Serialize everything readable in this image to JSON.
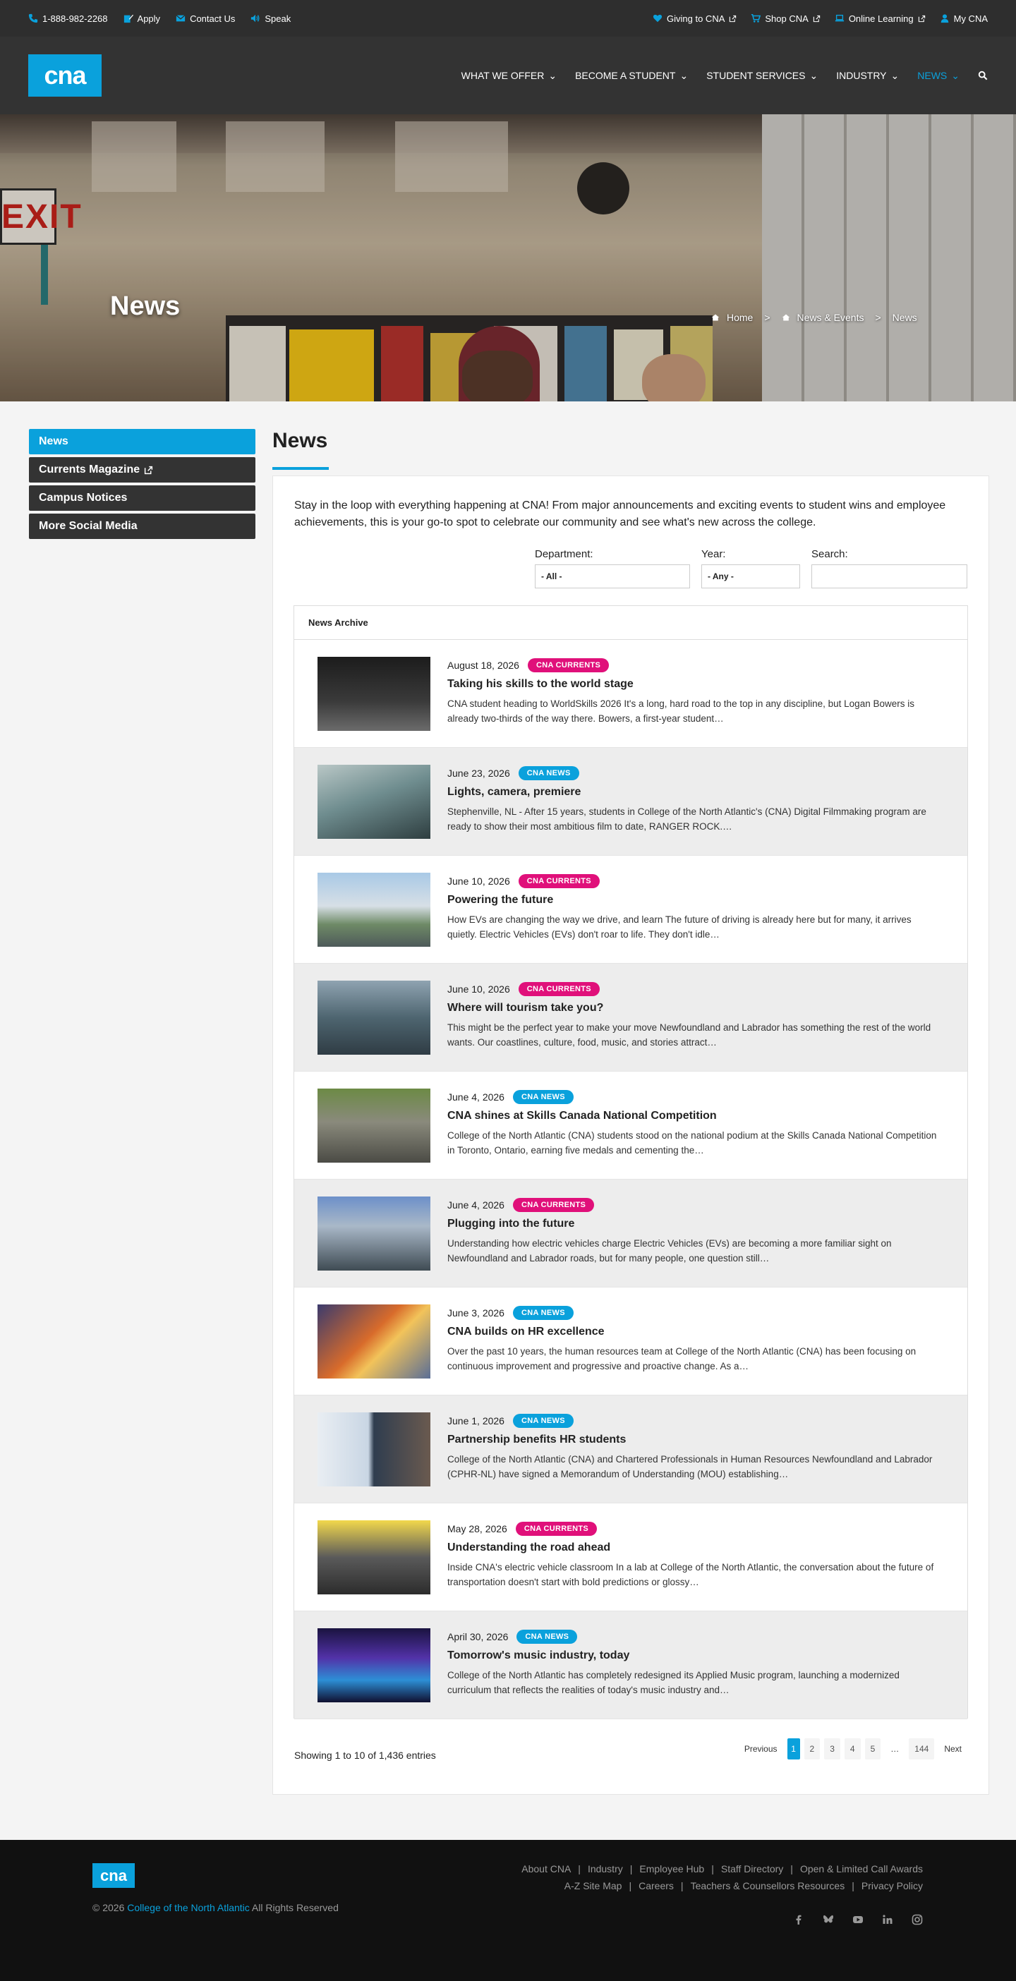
{
  "topbar": {
    "phone": "1-888-982-2268",
    "apply": "Apply",
    "contact": "Contact Us",
    "speak": "Speak",
    "giving": "Giving to CNA",
    "shop": "Shop CNA",
    "learning": "Online Learning",
    "mycna": "My CNA"
  },
  "nav": {
    "logo": "cna",
    "items": [
      "WHAT WE OFFER",
      "BECOME A STUDENT",
      "STUDENT SERVICES",
      "INDUSTRY",
      "NEWS"
    ]
  },
  "hero": {
    "title": "News",
    "exit_sign": "EXIT",
    "crumbs": [
      "Home",
      "News & Events",
      "News"
    ]
  },
  "sidebar": {
    "items": [
      "News",
      "Currents Magazine",
      "Campus Notices",
      "More Social Media"
    ]
  },
  "main": {
    "title": "News",
    "intro": "Stay in the loop with everything happening at CNA! From major announcements and exciting events to student wins and employee achievements, this is your go-to spot to celebrate our community and see what's new across the college.",
    "filters": {
      "department_label": "Department:",
      "department_value": "- All -",
      "year_label": "Year:",
      "year_value": "- Any -",
      "search_label": "Search:",
      "search_value": ""
    },
    "archive_title": "News Archive",
    "articles": [
      {
        "date": "August 18, 2026",
        "tag": "CNA CURRENTS",
        "title": "Taking his skills to the world stage",
        "excerpt": "CNA student heading to WorldSkills 2026 It's a long, hard road to the top in any discipline, but Logan Bowers is already two-thirds of the way there. Bowers, a first-year student…"
      },
      {
        "date": "June 23, 2026",
        "tag": "CNA NEWS",
        "title": "Lights, camera, premiere",
        "excerpt": "Stephenville, NL - After 15 years, students in College of the North Atlantic's (CNA) Digital Filmmaking program are ready to show their most ambitious film to date, RANGER ROCK.…"
      },
      {
        "date": "June 10, 2026",
        "tag": "CNA CURRENTS",
        "title": "Powering the future",
        "excerpt": "How EVs are changing the way we drive, and learn The future of driving is already here but for many, it arrives quietly. Electric Vehicles (EVs) don't roar to life. They don't idle…"
      },
      {
        "date": "June 10, 2026",
        "tag": "CNA CURRENTS",
        "title": "Where will tourism take you?",
        "excerpt": "This might be the perfect year to make your move Newfoundland and Labrador has something the rest of the world wants. Our coastlines, culture, food, music, and stories attract…"
      },
      {
        "date": "June 4, 2026",
        "tag": "CNA NEWS",
        "title": "CNA shines at Skills Canada National Competition",
        "excerpt": "College of the North Atlantic (CNA) students stood on the national podium at the Skills Canada National Competition in Toronto, Ontario, earning five medals and cementing the…"
      },
      {
        "date": "June 4, 2026",
        "tag": "CNA CURRENTS",
        "title": "Plugging into the future",
        "excerpt": "Understanding how electric vehicles charge Electric Vehicles (EVs) are becoming a more familiar sight on Newfoundland and Labrador roads, but for many people, one question still…"
      },
      {
        "date": "June 3, 2026",
        "tag": "CNA NEWS",
        "title": "CNA builds on HR excellence",
        "excerpt": "Over the past 10 years, the human resources team at College of the North Atlantic (CNA) has been focusing on continuous improvement and progressive and proactive change. As a…"
      },
      {
        "date": "June 1, 2026",
        "tag": "CNA NEWS",
        "title": "Partnership benefits HR students",
        "excerpt": "College of the North Atlantic (CNA) and Chartered Professionals in Human Resources Newfoundland and Labrador (CPHR-NL) have signed a Memorandum of Understanding (MOU) establishing…"
      },
      {
        "date": "May 28, 2026",
        "tag": "CNA CURRENTS",
        "title": "Understanding the road ahead",
        "excerpt": "Inside CNA's electric vehicle classroom In a lab at College of the North Atlantic, the conversation about the future of transportation doesn't start with bold predictions or glossy…"
      },
      {
        "date": "April 30, 2026",
        "tag": "CNA NEWS",
        "title": "Tomorrow's music industry, today",
        "excerpt": "College of the North Atlantic has completely redesigned its Applied Music program, launching a modernized curriculum that reflects the realities of today's music industry and…"
      }
    ],
    "showing": "Showing 1 to 10 of 1,436 entries",
    "pager": {
      "prev": "Previous",
      "pages": [
        "1",
        "2",
        "3",
        "4",
        "5",
        "…",
        "144"
      ],
      "next": "Next"
    }
  },
  "footer": {
    "logo": "cna",
    "copy_pre": "© 2026",
    "copy_link": "College of the North Atlantic",
    "copy_post": "All Rights Reserved",
    "links_row1": [
      "About CNA",
      "Industry",
      "Employee Hub",
      "Staff Directory",
      "Open & Limited Call Awards"
    ],
    "links_row2": [
      "A-Z Site Map",
      "Careers",
      "Teachers & Counsellors Resources",
      "Privacy Policy"
    ],
    "social": [
      "facebook-icon",
      "bluesky-icon",
      "youtube-icon",
      "linkedin-icon",
      "instagram-icon"
    ]
  },
  "colors": {
    "accent": "#0aa1dc",
    "currents": "#e0107a",
    "news": "#0aa1dc",
    "topbar": "#2e2e2e",
    "nav": "#333333",
    "footer": "#111111"
  }
}
